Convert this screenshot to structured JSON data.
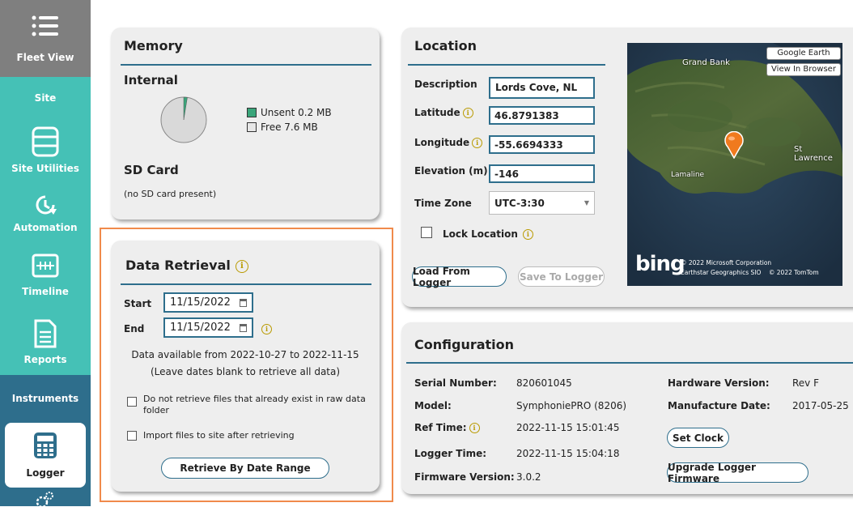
{
  "sidebar": {
    "items": [
      {
        "label": "Fleet View",
        "icon": "list-icon"
      },
      {
        "label": "Site",
        "icon": ""
      },
      {
        "label": "Site Utilities",
        "icon": "database-icon"
      },
      {
        "label": "Automation",
        "icon": "clock-arrow-icon"
      },
      {
        "label": "Timeline",
        "icon": "timeline-icon"
      },
      {
        "label": "Reports",
        "icon": "document-icon"
      },
      {
        "label": "Instruments",
        "icon": ""
      },
      {
        "label": "Logger",
        "icon": "calculator-icon"
      }
    ],
    "colors": {
      "dark": "#7f7f7f",
      "teal": "#45c1b6",
      "navy": "#2e6e8c",
      "selected": "#ffffff"
    }
  },
  "memory": {
    "title": "Memory",
    "internal_label": "Internal",
    "legend_unsent": "Unsent 0.2 MB",
    "legend_free": "Free 7.6 MB",
    "unsent_mb": 0.2,
    "free_mb": 7.6,
    "sd_title": "SD Card",
    "sd_status": "(no SD card present)"
  },
  "retrieval": {
    "title": "Data Retrieval",
    "start_label": "Start",
    "start_value": "11/15/2022",
    "end_label": "End",
    "end_value": "11/15/2022",
    "available": "Data available from 2022-10-27 to 2022-11-15",
    "hint": "(Leave dates blank to retrieve all data)",
    "skip_existing": "Do not retrieve files that already exist in raw data folder",
    "import_after": "Import files to site after retrieving",
    "retrieve_button": "Retrieve By Date Range",
    "highlight_color": "#f08a4b"
  },
  "location": {
    "title": "Location",
    "description_label": "Description",
    "description_value": "Lords Cove, NL",
    "latitude_label": "Latitude",
    "latitude_value": "46.8791383",
    "longitude_label": "Longitude",
    "longitude_value": "-55.6694333",
    "elevation_label": "Elevation (m)",
    "elevation_value": "-146",
    "timezone_label": "Time Zone",
    "timezone_value": "UTC-3:30",
    "lock_label": "Lock Location",
    "load_button": "Load From Logger",
    "save_button": "Save To Logger",
    "map": {
      "google_earth": "Google Earth",
      "view_browser": "View In Browser",
      "place_grand_bank": "Grand Bank",
      "place_st_lawrence": "St Lawrence",
      "place_lamaline": "Lamaline",
      "bing": "bing",
      "copyright1": "© 2022 Microsoft Corporation",
      "copyright2": "Earthstar Geographics SIO    © 2022 TomTom"
    }
  },
  "configuration": {
    "title": "Configuration",
    "serial_label": "Serial Number:",
    "serial_value": "820601045",
    "model_label": "Model:",
    "model_value": "SymphoniePRO (8206)",
    "reftime_label": "Ref Time:",
    "reftime_value": "2022-11-15 15:01:45",
    "loggertime_label": "Logger Time:",
    "loggertime_value": "2022-11-15 15:04:18",
    "firmware_label": "Firmware Version:",
    "firmware_value": "3.0.2",
    "hwversion_label": "Hardware Version:",
    "hwversion_value": "Rev F",
    "mfgdate_label": "Manufacture Date:",
    "mfgdate_value": "2017-05-25",
    "setclock_button": "Set Clock",
    "upgrade_button": "Upgrade Logger Firmware"
  }
}
